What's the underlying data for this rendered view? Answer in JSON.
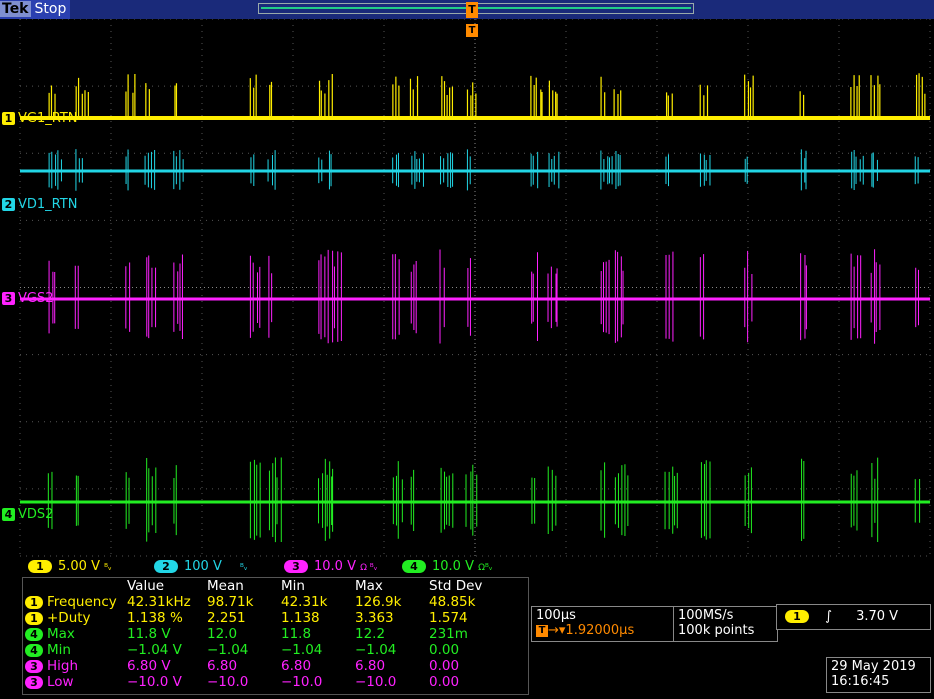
{
  "header": {
    "brand": "Tek",
    "state": "Stop"
  },
  "trigger_marker": "T",
  "channels": [
    {
      "num": "1",
      "label": "VG1_RTN",
      "color": "#ffee00"
    },
    {
      "num": "2",
      "label": "VD1_RTN",
      "color": "#22d6e6"
    },
    {
      "num": "3",
      "label": "VGS2",
      "color": "#ff22ff"
    },
    {
      "num": "4",
      "label": "VDS2",
      "color": "#22ee22"
    }
  ],
  "scales": [
    {
      "num": "1",
      "value": "5.00 V",
      "suffix": "ᴮᵥ"
    },
    {
      "num": "2",
      "value": "100 V",
      "suffix": "ᴮᵥ"
    },
    {
      "num": "3",
      "value": "10.0 V",
      "suffix": "Ω ᴮᵥ"
    },
    {
      "num": "4",
      "value": "10.0 V",
      "suffix": "Ωᴮᵥ"
    }
  ],
  "measurements": {
    "headers": [
      "Value",
      "Mean",
      "Min",
      "Max",
      "Std Dev"
    ],
    "rows": [
      {
        "ch": "1",
        "name": "Frequency",
        "value": "42.31kHz",
        "mean": "98.71k",
        "min": "42.31k",
        "max": "126.9k",
        "std": "48.85k"
      },
      {
        "ch": "1",
        "name": "+Duty",
        "value": "1.138 %",
        "mean": "2.251",
        "min": "1.138",
        "max": "3.363",
        "std": "1.574"
      },
      {
        "ch": "4",
        "name": "Max",
        "value": "11.8 V",
        "mean": "12.0",
        "min": "11.8",
        "max": "12.2",
        "std": "231m"
      },
      {
        "ch": "4",
        "name": "Min",
        "value": "−1.04 V",
        "mean": "−1.04",
        "min": "−1.04",
        "max": "−1.04",
        "std": "0.00"
      },
      {
        "ch": "3",
        "name": "High",
        "value": "6.80 V",
        "mean": "6.80",
        "min": "6.80",
        "max": "6.80",
        "std": "0.00"
      },
      {
        "ch": "3",
        "name": "Low",
        "value": "−10.0 V",
        "mean": "−10.0",
        "min": "−10.0",
        "max": "−10.0",
        "std": "0.00"
      }
    ]
  },
  "timebase": {
    "scale": "100µs",
    "trigger_pos": "1.92000µs"
  },
  "acquisition": {
    "rate": "100MS/s",
    "points": "100k points"
  },
  "trigger": {
    "source": "1",
    "slope": "∫",
    "level": "3.70 V"
  },
  "datetime": {
    "date": "29 May 2019",
    "time": "16:16:45"
  }
}
